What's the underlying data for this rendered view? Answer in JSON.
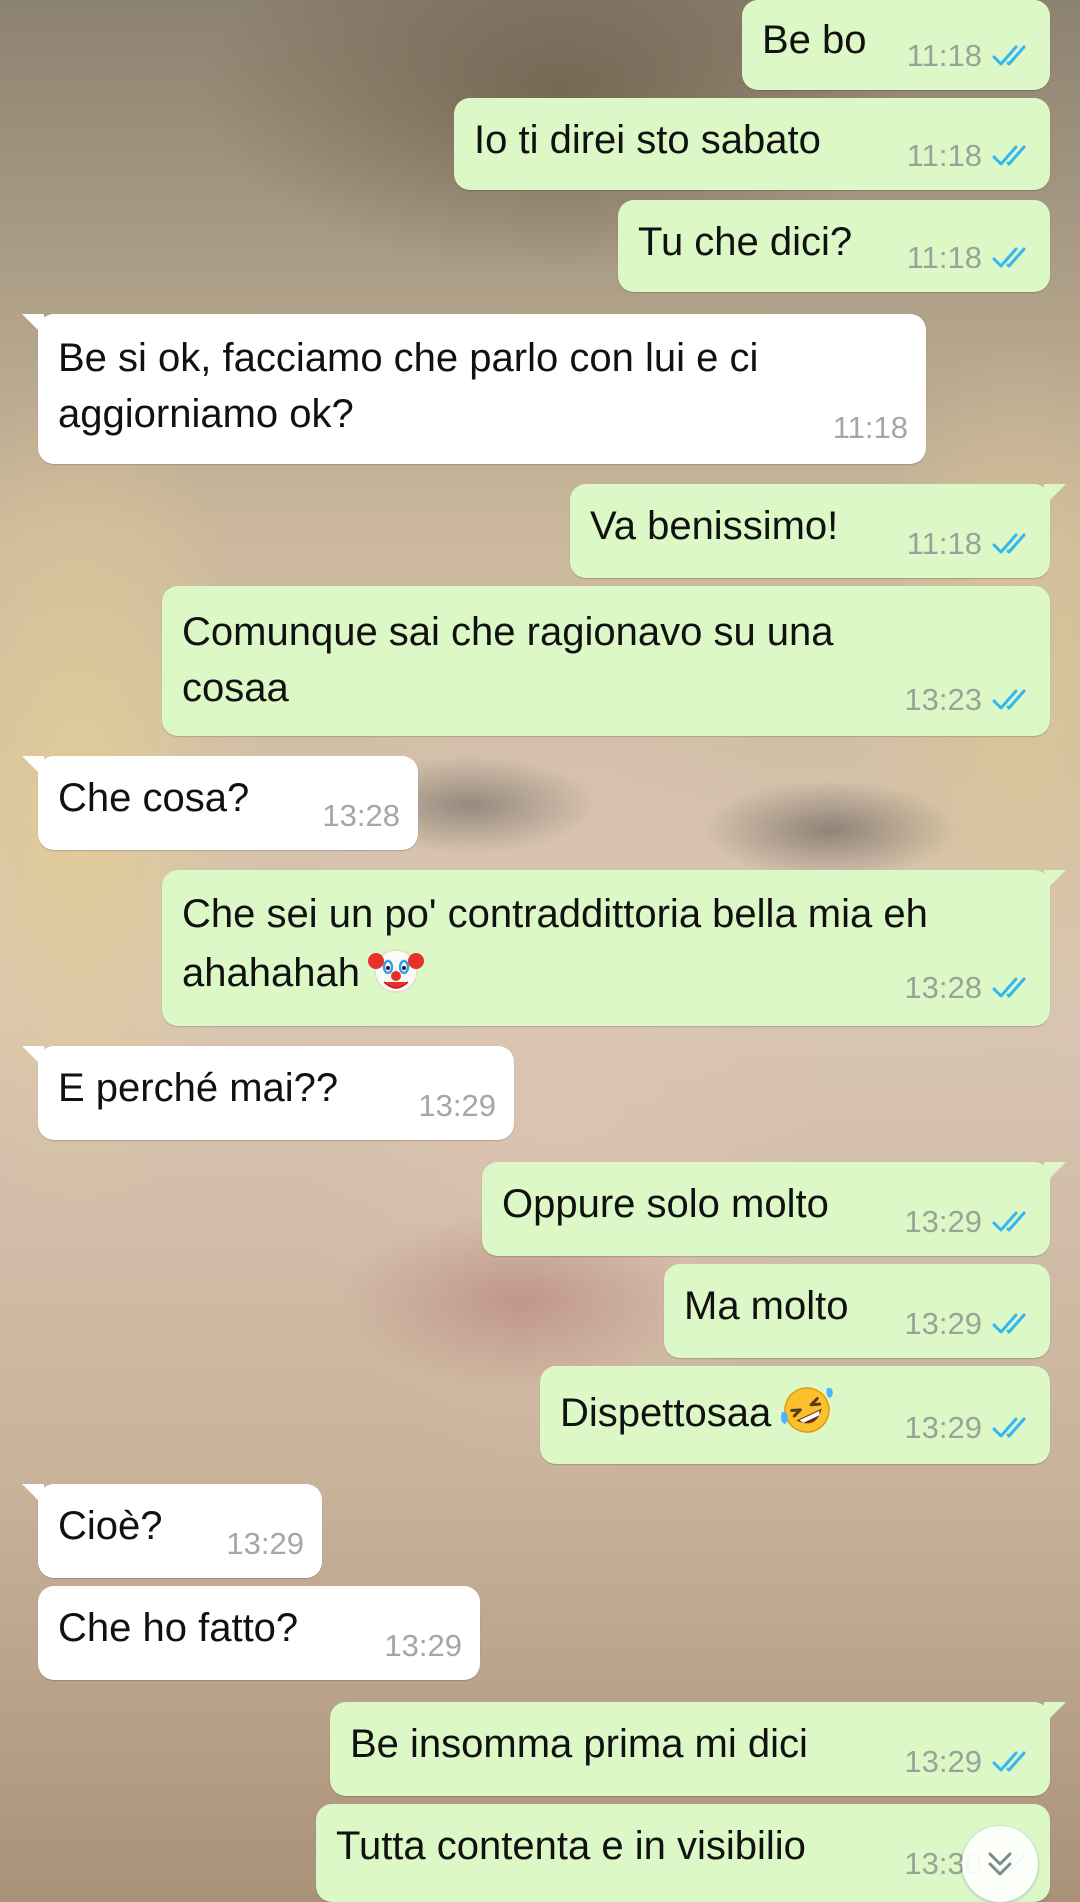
{
  "chat": {
    "messages": [
      {
        "text": "Be bo",
        "time": "11:18",
        "status": "read"
      },
      {
        "text": "Io ti direi sto sabato",
        "time": "11:18",
        "status": "read"
      },
      {
        "text": "Tu che dici?",
        "time": "11:18",
        "status": "read"
      },
      {
        "text": "Be si ok, facciamo che parlo con lui e ci\naggiorniamo ok?",
        "time": "11:18"
      },
      {
        "text": "Va benissimo!",
        "time": "11:18",
        "status": "read"
      },
      {
        "text": "Comunque sai che ragionavo su una\ncosaa",
        "time": "13:23",
        "status": "read"
      },
      {
        "text": "Che cosa?",
        "time": "13:28"
      },
      {
        "text": "Che sei un po' contraddittoria bella mia eh\nahahahah",
        "time": "13:28",
        "status": "read",
        "emoji": "clown-face-emoji"
      },
      {
        "text": "E perché mai??",
        "time": "13:29"
      },
      {
        "text": "Oppure solo molto",
        "time": "13:29",
        "status": "read"
      },
      {
        "text": "Ma molto",
        "time": "13:29",
        "status": "read"
      },
      {
        "text": "Dispettosaa",
        "time": "13:29",
        "status": "read",
        "emoji": "rolling-on-the-floor-laughing-emoji"
      },
      {
        "text": "Cioè?",
        "time": "13:29"
      },
      {
        "text": "Che ho fatto?",
        "time": "13:29"
      },
      {
        "text": "Be insomma prima mi dici",
        "time": "13:29",
        "status": "read"
      },
      {
        "text": "Tutta contenta e in visibilio",
        "time": "13:30",
        "status": "read"
      }
    ],
    "scroll_button_icon": "double-chevron-down-icon"
  },
  "colors": {
    "outgoing_bubble": "#dcf8c6",
    "incoming_bubble": "#ffffff",
    "read_ticks": "#34b7f1",
    "timestamp": "#9aa39a"
  }
}
